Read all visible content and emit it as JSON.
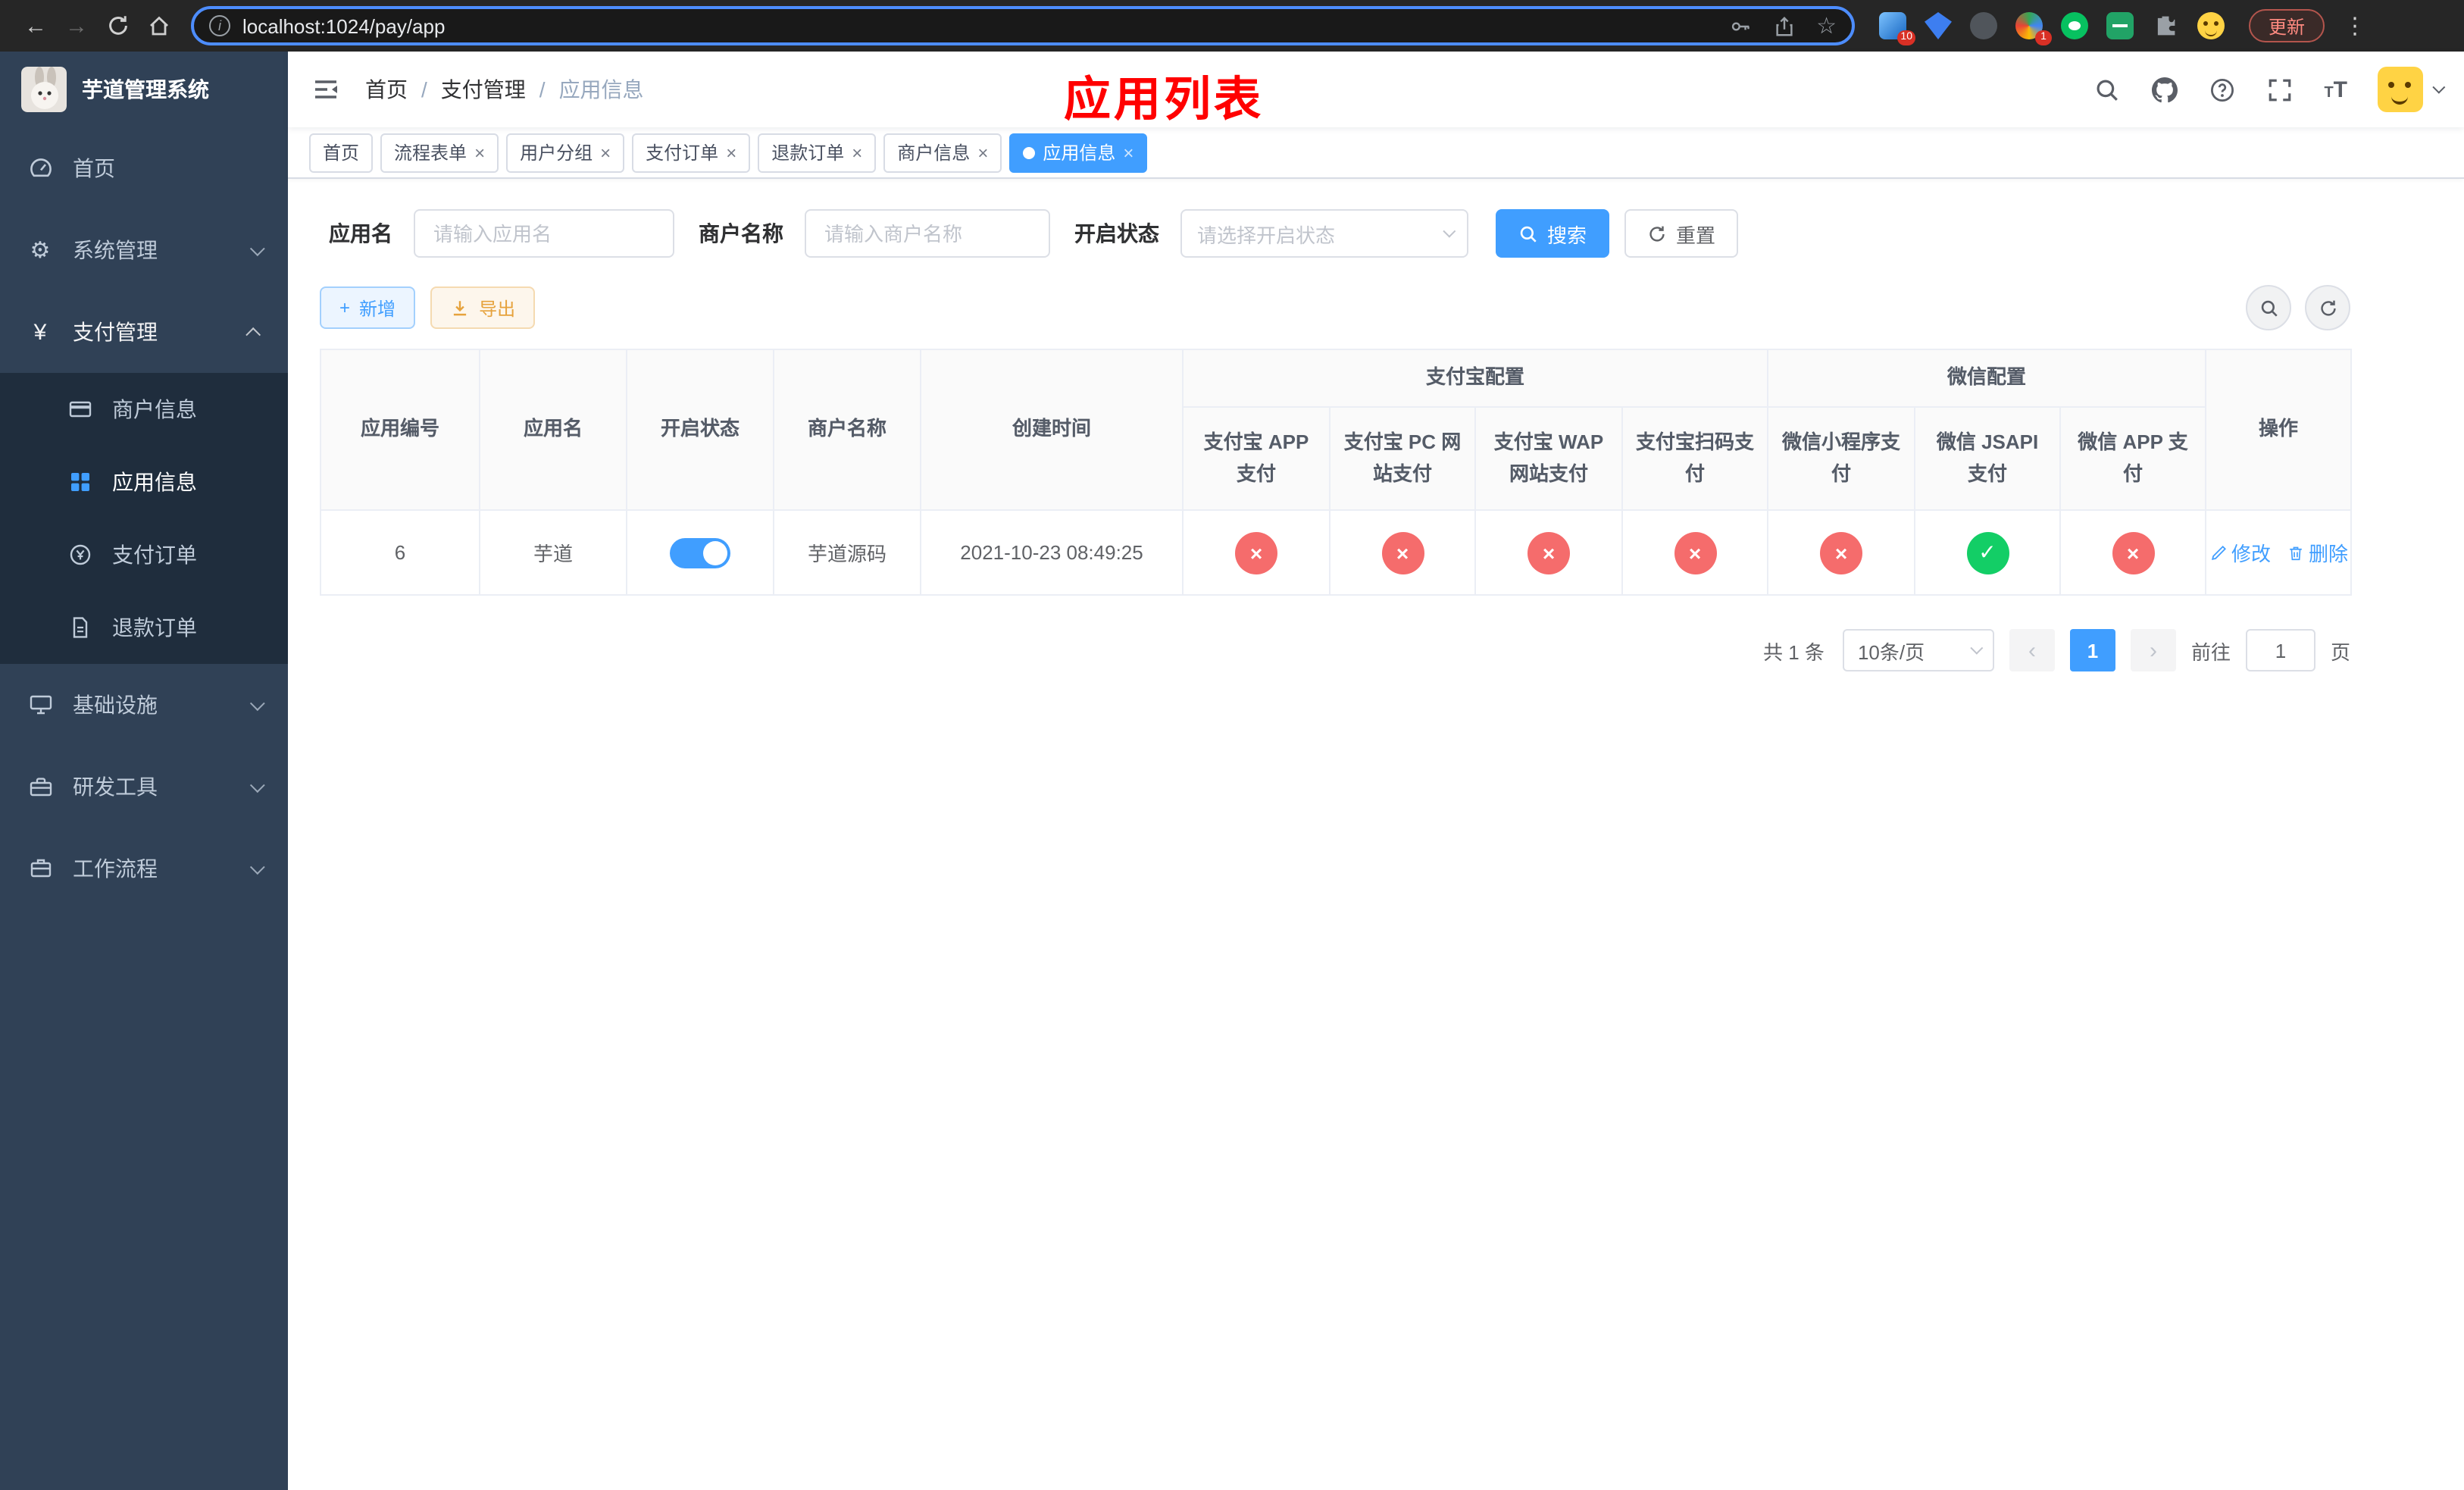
{
  "browser": {
    "url": "localhost:1024/pay/app",
    "update_label": "更新",
    "extension_badge_1": "10",
    "extension_badge_2": "1"
  },
  "icons": {
    "close": "×",
    "check": "✓",
    "cross": "×",
    "star": "☆",
    "kebab": "⋮",
    "gear": "⚙",
    "yuan": "¥",
    "plus": "+",
    "prev": "‹",
    "next": "›",
    "back": "←",
    "forward": "→"
  },
  "colors": {
    "primary": "#409EFF",
    "danger": "#f56c6c",
    "success": "#13ce66"
  },
  "sidebar": {
    "title": "芋道管理系统",
    "items": [
      {
        "label": "首页"
      },
      {
        "label": "系统管理"
      },
      {
        "label": "支付管理"
      },
      {
        "label": "基础设施"
      },
      {
        "label": "研发工具"
      },
      {
        "label": "工作流程"
      }
    ],
    "payment_submenu": [
      {
        "label": "商户信息"
      },
      {
        "label": "应用信息"
      },
      {
        "label": "支付订单"
      },
      {
        "label": "退款订单"
      }
    ]
  },
  "navbar": {
    "breadcrumb": [
      "首页",
      "支付管理",
      "应用信息"
    ],
    "separator": "/"
  },
  "annotation": "应用列表",
  "tabs": [
    {
      "label": "首页"
    },
    {
      "label": "流程表单"
    },
    {
      "label": "用户分组"
    },
    {
      "label": "支付订单"
    },
    {
      "label": "退款订单"
    },
    {
      "label": "商户信息"
    },
    {
      "label": "应用信息"
    }
  ],
  "filters": {
    "app_name_label": "应用名",
    "app_name_placeholder": "请输入应用名",
    "merchant_label": "商户名称",
    "merchant_placeholder": "请输入商户名称",
    "status_label": "开启状态",
    "status_placeholder": "请选择开启状态",
    "search_label": "搜索",
    "reset_label": "重置"
  },
  "toolbar": {
    "add_label": "新增",
    "export_label": "导出"
  },
  "table": {
    "group_alipay": "支付宝配置",
    "group_wechat": "微信配置",
    "columns": [
      "应用编号",
      "应用名",
      "开启状态",
      "商户名称",
      "创建时间",
      "支付宝 APP 支付",
      "支付宝 PC 网站支付",
      "支付宝 WAP 网站支付",
      "支付宝扫码支付",
      "微信小程序支付",
      "微信 JSAPI 支付",
      "微信 APP 支付",
      "操作"
    ],
    "rows": [
      {
        "id": "6",
        "name": "芋道",
        "enabled": true,
        "merchant": "芋道源码",
        "created": "2021-10-23 08:49:25",
        "configs": [
          false,
          false,
          false,
          false,
          false,
          true,
          false
        ],
        "edit_label": "修改",
        "delete_label": "删除"
      }
    ]
  },
  "pagination": {
    "total": "共 1 条",
    "page_size": "10条/页",
    "page": "1",
    "goto_label": "前往",
    "goto_value": "1",
    "unit_label": "页"
  }
}
